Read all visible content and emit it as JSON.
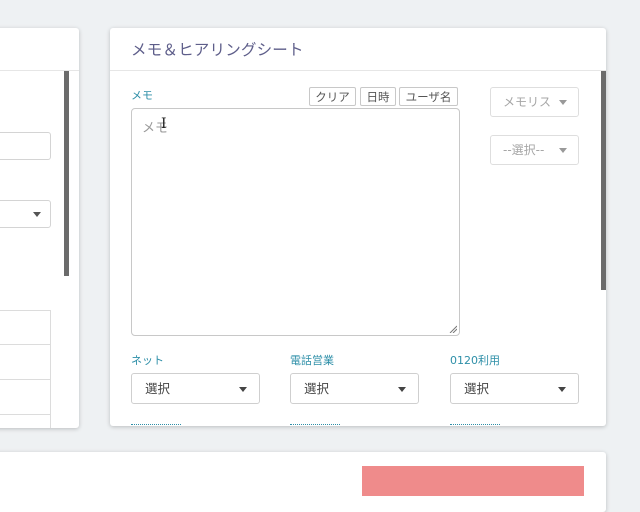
{
  "memo_panel": {
    "title": "メモ＆ヒアリングシート",
    "memo_label": "メモ",
    "buttons": {
      "clear": "クリア",
      "datetime": "日時",
      "username": "ユーザ名"
    },
    "textarea_placeholder": "メモ",
    "memo_list_select": "メモリス",
    "choice_select": "--選択--",
    "fields": [
      {
        "label": "ネット",
        "value": "選択"
      },
      {
        "label": "電話営業",
        "value": "選択"
      },
      {
        "label": "0120利用",
        "value": "選択"
      }
    ]
  },
  "left_panel": {
    "partial_label": ")"
  },
  "colors": {
    "label_teal": "#2e8fa8",
    "title_purple": "#5e5e8a",
    "alert_bar": "#ef8b8b",
    "background": "#eef1f3"
  }
}
